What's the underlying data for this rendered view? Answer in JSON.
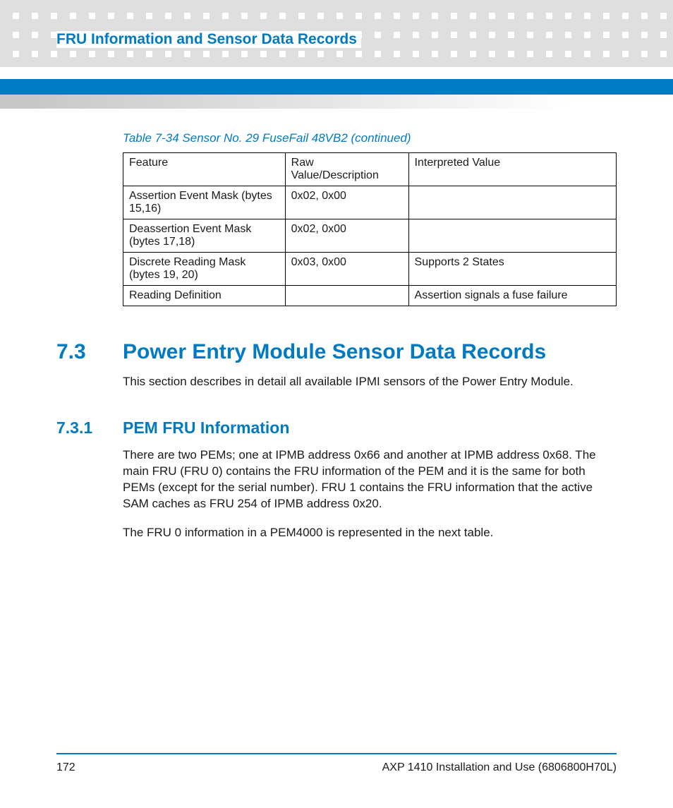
{
  "header": {
    "chapter_title": "FRU Information and Sensor Data Records"
  },
  "table": {
    "caption": "Table 7-34 Sensor No. 29 FuseFail 48VB2 (continued)",
    "headers": [
      "Feature",
      "Raw Value/Description",
      "Interpreted Value"
    ],
    "rows": [
      {
        "feature": "Assertion Event Mask (bytes 15,16)",
        "raw": "0x02, 0x00",
        "interp": ""
      },
      {
        "feature": "Deassertion Event Mask (bytes 17,18)",
        "raw": "0x02, 0x00",
        "interp": ""
      },
      {
        "feature": "Discrete Reading Mask (bytes 19, 20)",
        "raw": "0x03, 0x00",
        "interp": "Supports 2 States"
      },
      {
        "feature": "Reading Definition",
        "raw": "",
        "interp": "Assertion signals a fuse failure"
      }
    ]
  },
  "section": {
    "number": "7.3",
    "title": "Power Entry Module Sensor Data Records",
    "intro": "This section describes in detail all available IPMI sensors of the Power Entry Module."
  },
  "subsection": {
    "number": "7.3.1",
    "title": "PEM FRU Information",
    "para1": "There are two PEMs; one at IPMB address 0x66 and another at IPMB address 0x68. The main FRU (FRU 0) contains the FRU information of the PEM and it is the same for both PEMs (except for the serial number). FRU 1 contains the FRU information that the active SAM caches as FRU 254 of IPMB address 0x20.",
    "para2": "The FRU 0 information in a PEM4000 is represented in the next table."
  },
  "footer": {
    "page": "172",
    "doc": "AXP 1410 Installation and Use (6806800H70L)"
  }
}
